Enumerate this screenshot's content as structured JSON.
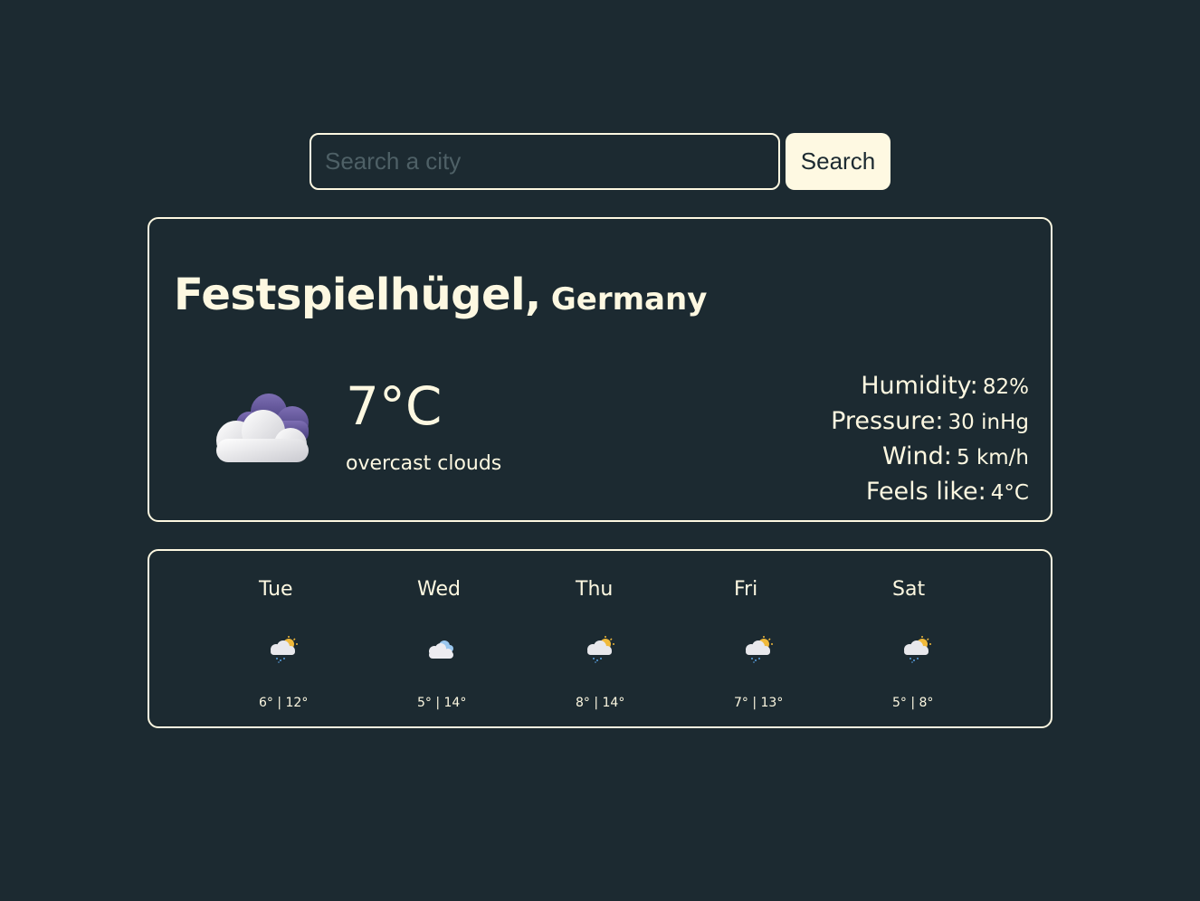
{
  "search": {
    "placeholder": "Search a city",
    "value": "",
    "button_label": "Search"
  },
  "current": {
    "city": "Festspielhügel,",
    "country": "Germany",
    "icon": "overcast-clouds-icon",
    "temperature": "7°C",
    "description": "overcast clouds",
    "details": [
      {
        "label": "Humidity:",
        "value": "82%"
      },
      {
        "label": "Pressure:",
        "value": "30 inHg"
      },
      {
        "label": "Wind:",
        "value": "5 km/h"
      },
      {
        "label": "Feels like:",
        "value": "4°C"
      }
    ]
  },
  "forecast": [
    {
      "day": "Tue",
      "icon": "sun-rain-cloud-icon",
      "temps": "6° | 12°"
    },
    {
      "day": "Wed",
      "icon": "cloud-icon",
      "temps": "5° | 14°"
    },
    {
      "day": "Thu",
      "icon": "sun-rain-cloud-icon",
      "temps": "8° | 14°"
    },
    {
      "day": "Fri",
      "icon": "sun-rain-cloud-icon",
      "temps": "7° | 13°"
    },
    {
      "day": "Sat",
      "icon": "sun-rain-cloud-icon",
      "temps": "5° | 8°"
    }
  ],
  "colors": {
    "background": "#1c2a31",
    "accent": "#fdf8e1",
    "button": "#fef9e2"
  }
}
